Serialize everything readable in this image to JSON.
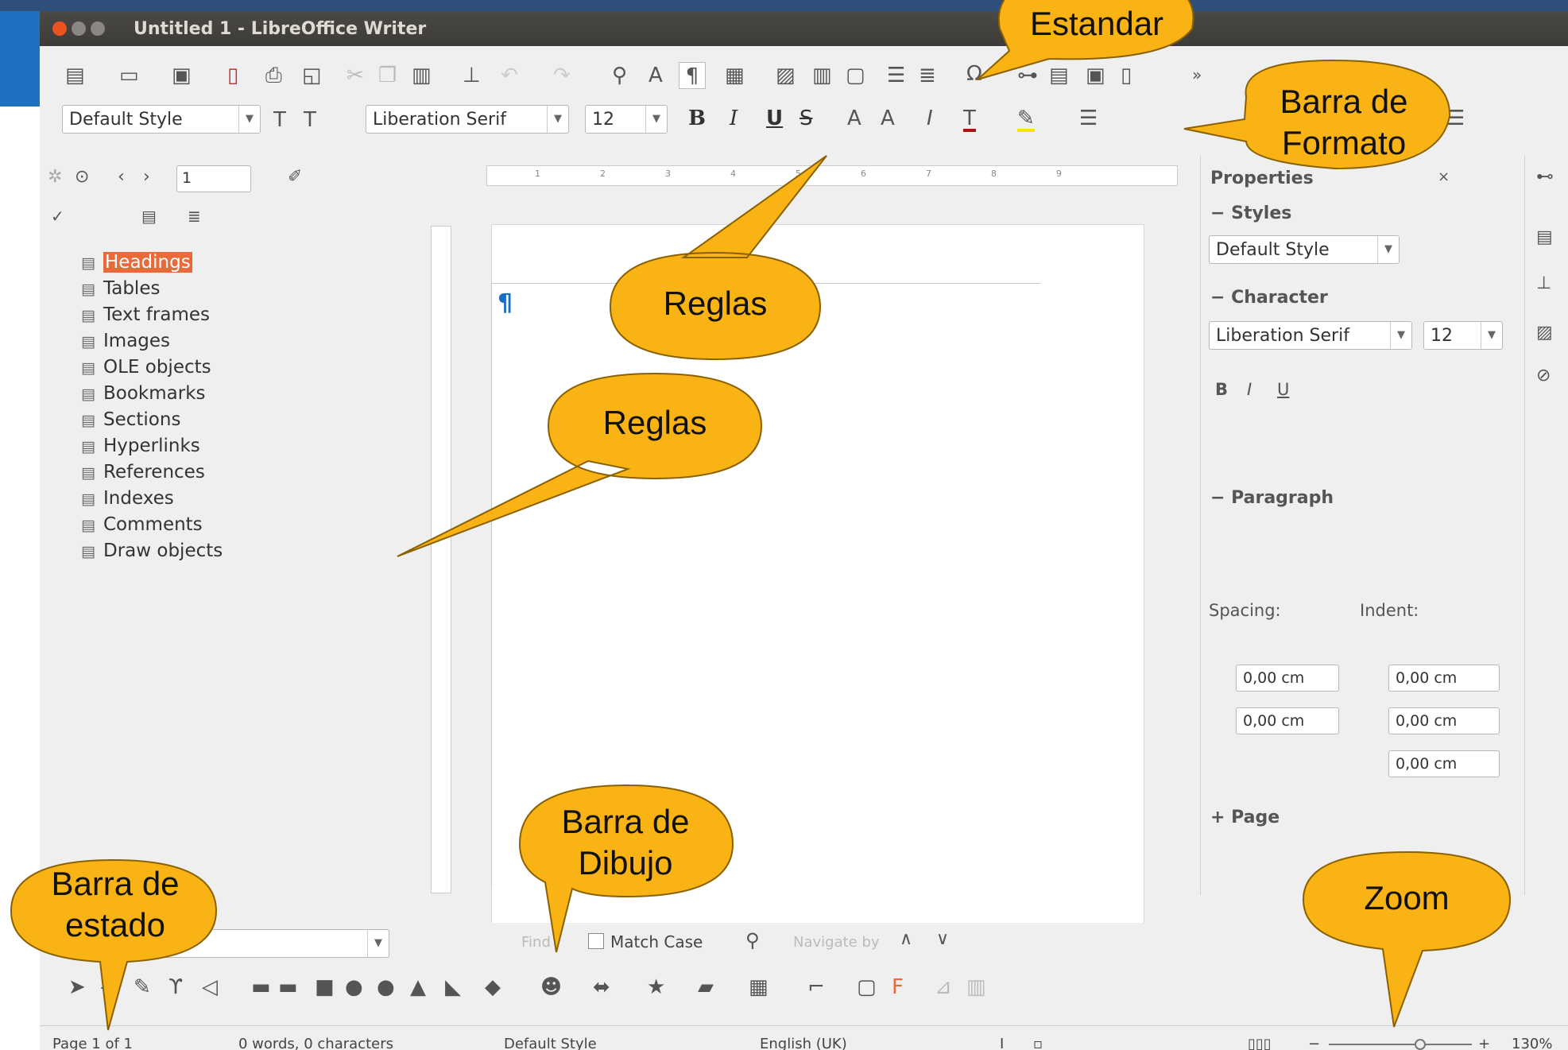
{
  "window": {
    "title": "Untitled 1 - LibreOffice Writer"
  },
  "toolbar_standard": {
    "icons": [
      "new-icon",
      "open-icon",
      "save-icon",
      "export-pdf-icon",
      "print-icon",
      "print-preview-icon",
      "cut-icon",
      "copy-icon",
      "paste-icon",
      "clone-formatting-icon",
      "undo-icon",
      "redo-icon",
      "find-replace-icon",
      "spelling-icon",
      "formatting-marks-icon",
      "insert-table-icon",
      "insert-image-icon",
      "insert-chart-icon",
      "insert-textbox-icon",
      "page-break-icon",
      "field-icon",
      "special-character-icon",
      "hyperlink-icon",
      "footnote-icon",
      "comment-icon",
      "track-changes-icon"
    ],
    "overflow": "»",
    "omega": "Ω"
  },
  "toolbar_formatting": {
    "paragraph_style": "Default Style",
    "font_name": "Liberation Serif",
    "font_size": "12",
    "bold": "B",
    "italic": "I",
    "underline": "U",
    "strikethrough": "S"
  },
  "navigator": {
    "page_number": "1",
    "items": [
      {
        "label": "Headings",
        "icon": "headings-icon",
        "highlight": true
      },
      {
        "label": "Tables",
        "icon": "tables-icon"
      },
      {
        "label": "Text frames",
        "icon": "text-frames-icon"
      },
      {
        "label": "Images",
        "icon": "images-icon"
      },
      {
        "label": "OLE objects",
        "icon": "ole-objects-icon"
      },
      {
        "label": "Bookmarks",
        "icon": "bookmarks-icon"
      },
      {
        "label": "Sections",
        "icon": "sections-icon"
      },
      {
        "label": "Hyperlinks",
        "icon": "hyperlinks-icon"
      },
      {
        "label": "References",
        "icon": "references-icon"
      },
      {
        "label": "Indexes",
        "icon": "indexes-icon"
      },
      {
        "label": "Comments",
        "icon": "comments-icon"
      },
      {
        "label": "Draw objects",
        "icon": "draw-objects-icon"
      }
    ]
  },
  "ruler": {
    "ticks": [
      "1",
      "2",
      "3",
      "4",
      "5",
      "6",
      "7",
      "8",
      "9"
    ]
  },
  "sidebar": {
    "title": "Properties",
    "styles_section": "Styles",
    "style_value": "Default Style",
    "character_section": "Character",
    "font_value": "Liberation Serif",
    "size_value": "12",
    "paragraph_section": "Paragraph",
    "spacing_label": "Spacing:",
    "indent_label": "Indent:",
    "spacing_above": "0,00 cm",
    "spacing_below": "0,00 cm",
    "indent_before": "0,00 cm",
    "indent_after": "0,00 cm",
    "indent_first": "0,00 cm",
    "page_section": "Page"
  },
  "findbar": {
    "find_placeholder": "Find",
    "match_case": "Match Case",
    "navigate_by": "Navigate by"
  },
  "statusbar": {
    "page": "Page 1 of 1",
    "words": "0 words, 0 characters",
    "style": "Default Style",
    "language": "English (UK)",
    "zoom": "130%"
  },
  "callouts": {
    "estandar": "Estandar",
    "barra_formato_1": "Barra de",
    "barra_formato_2": "Formato",
    "reglas_1": "Reglas",
    "reglas_2": "Reglas",
    "barra_dibujo_1": "Barra de",
    "barra_dibujo_2": "Dibujo",
    "barra_estado_1": "Barra de",
    "barra_estado_2": "estado",
    "zoom": "Zoom"
  },
  "colors": {
    "callout_fill": "#f9b315",
    "callout_stroke": "#8a6100",
    "highlight": "#e96a39",
    "pilcrow": "#1a6ec2"
  }
}
